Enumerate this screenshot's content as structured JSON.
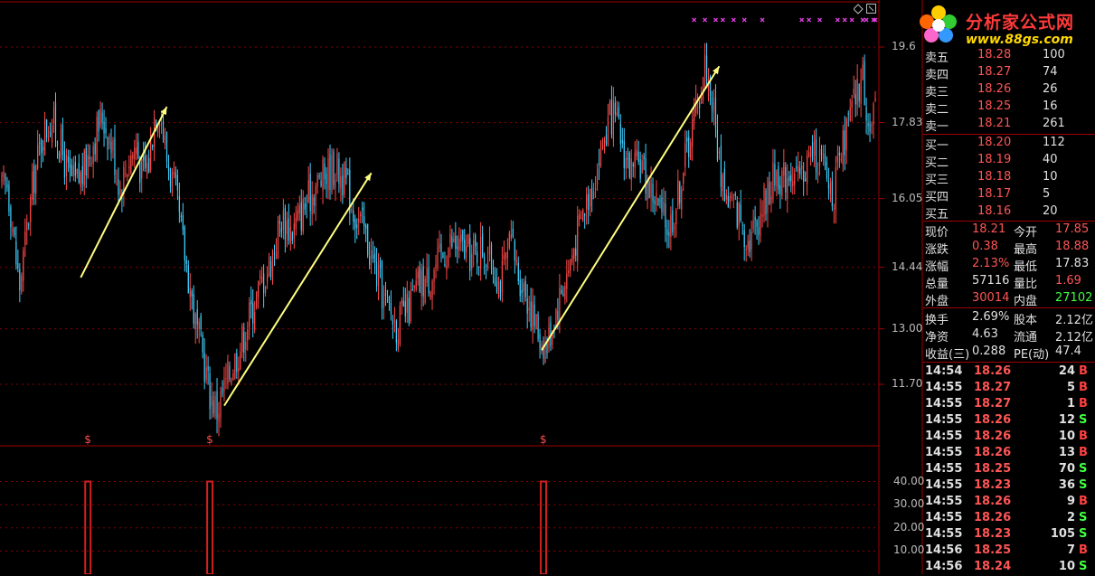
{
  "colors": {
    "up": "#ff4a4a",
    "down": "#40d0ff",
    "grid": "#8b0000",
    "arrow": "#ffff80",
    "signal": "#e040e0",
    "bar": "#d02020"
  },
  "logo": {
    "name": "分析家公式网",
    "url": "www.88gs.com"
  },
  "price_axis": {
    "labels": [
      "19.6",
      "17.83",
      "16.05",
      "14.44",
      "13.00",
      "11.70"
    ]
  },
  "volume_axis": {
    "labels": [
      "40.00",
      "30.00",
      "20.00",
      "10.00"
    ]
  },
  "window_icons": [
    "restore-icon",
    "close-icon"
  ],
  "dollar_markers": [
    "$",
    "$",
    "$"
  ],
  "quote_ask": [
    {
      "label": "卖五",
      "price": "18.28",
      "vol": "100"
    },
    {
      "label": "卖四",
      "price": "18.27",
      "vol": "74"
    },
    {
      "label": "卖三",
      "price": "18.26",
      "vol": "26"
    },
    {
      "label": "卖二",
      "price": "18.25",
      "vol": "16"
    },
    {
      "label": "卖一",
      "price": "18.21",
      "vol": "261"
    }
  ],
  "quote_bid": [
    {
      "label": "买一",
      "price": "18.20",
      "vol": "112"
    },
    {
      "label": "买二",
      "price": "18.19",
      "vol": "40"
    },
    {
      "label": "买三",
      "price": "18.18",
      "vol": "10"
    },
    {
      "label": "买四",
      "price": "18.17",
      "vol": "5"
    },
    {
      "label": "买五",
      "price": "18.16",
      "vol": "20"
    }
  ],
  "stats": [
    {
      "l1": "现价",
      "v1": "18.21",
      "l2": "今开",
      "v2": "17.85",
      "c1": "#ff5555",
      "c2": "#ff5555"
    },
    {
      "l1": "涨跌",
      "v1": "0.38",
      "l2": "最高",
      "v2": "18.88",
      "c1": "#ff5555",
      "c2": "#ff5555"
    },
    {
      "l1": "涨幅",
      "v1": "2.13%",
      "l2": "最低",
      "v2": "17.83",
      "c1": "#ff5555",
      "c2": "#e0e0e0"
    },
    {
      "l1": "总量",
      "v1": "57116",
      "l2": "量比",
      "v2": "1.69",
      "c1": "#e0e0e0",
      "c2": "#ff5555"
    },
    {
      "l1": "外盘",
      "v1": "30014",
      "l2": "内盘",
      "v2": "27102",
      "c1": "#ff5555",
      "c2": "#40ff40"
    },
    {
      "l1": "换手",
      "v1": "2.69%",
      "l2": "股本",
      "v2": "2.12亿",
      "c1": "#e0e0e0",
      "c2": "#e0e0e0"
    },
    {
      "l1": "净资",
      "v1": "4.63",
      "l2": "流通",
      "v2": "2.12亿",
      "c1": "#e0e0e0",
      "c2": "#e0e0e0"
    },
    {
      "l1": "收益(三)",
      "v1": "0.288",
      "l2": "PE(动)",
      "v2": "47.4",
      "c1": "#e0e0e0",
      "c2": "#e0e0e0"
    }
  ],
  "ticks": [
    {
      "time": "14:54",
      "price": "18.26",
      "vol": "24",
      "dir": "B"
    },
    {
      "time": "14:55",
      "price": "18.27",
      "vol": "5",
      "dir": "B"
    },
    {
      "time": "14:55",
      "price": "18.27",
      "vol": "1",
      "dir": "B"
    },
    {
      "time": "14:55",
      "price": "18.26",
      "vol": "12",
      "dir": "S"
    },
    {
      "time": "14:55",
      "price": "18.26",
      "vol": "10",
      "dir": "B"
    },
    {
      "time": "14:55",
      "price": "18.26",
      "vol": "13",
      "dir": "B"
    },
    {
      "time": "14:55",
      "price": "18.25",
      "vol": "70",
      "dir": "S"
    },
    {
      "time": "14:55",
      "price": "18.23",
      "vol": "36",
      "dir": "S"
    },
    {
      "time": "14:55",
      "price": "18.26",
      "vol": "9",
      "dir": "B"
    },
    {
      "time": "14:55",
      "price": "18.26",
      "vol": "2",
      "dir": "S"
    },
    {
      "time": "14:55",
      "price": "18.23",
      "vol": "105",
      "dir": "S"
    },
    {
      "time": "14:56",
      "price": "18.25",
      "vol": "7",
      "dir": "B"
    },
    {
      "time": "14:56",
      "price": "18.24",
      "vol": "10",
      "dir": "S"
    }
  ],
  "chart_data": {
    "type": "candlestick",
    "title": "",
    "ylim": [
      11.0,
      19.9
    ],
    "yticks": [
      19.6,
      17.83,
      16.05,
      14.44,
      13.0,
      11.7
    ],
    "volume_ylim": [
      0,
      48
    ],
    "volume_yticks": [
      40,
      30,
      20,
      10
    ],
    "waypoints": [
      [
        0,
        16.3
      ],
      [
        3,
        16.4
      ],
      [
        5,
        15.8
      ],
      [
        8,
        14.6
      ],
      [
        10,
        14.0
      ],
      [
        13,
        15.0
      ],
      [
        18,
        16.6
      ],
      [
        23,
        17.6
      ],
      [
        28,
        17.9
      ],
      [
        32,
        17.4
      ],
      [
        37,
        16.6
      ],
      [
        41,
        16.4
      ],
      [
        45,
        16.6
      ],
      [
        50,
        17.3
      ],
      [
        56,
        18.0
      ],
      [
        62,
        17.2
      ],
      [
        66,
        16.3
      ],
      [
        70,
        16.9
      ],
      [
        75,
        17.3
      ],
      [
        78,
        16.6
      ],
      [
        82,
        16.9
      ],
      [
        85,
        18.0
      ],
      [
        88,
        18.2
      ],
      [
        92,
        17.0
      ],
      [
        97,
        16.1
      ],
      [
        101,
        15.0
      ],
      [
        105,
        14.0
      ],
      [
        108,
        13.1
      ],
      [
        112,
        12.4
      ],
      [
        116,
        11.5
      ],
      [
        120,
        11.1
      ],
      [
        124,
        11.6
      ],
      [
        128,
        12.1
      ],
      [
        133,
        12.6
      ],
      [
        138,
        13.3
      ],
      [
        144,
        14.0
      ],
      [
        150,
        14.6
      ],
      [
        156,
        15.6
      ],
      [
        162,
        15.3
      ],
      [
        168,
        15.8
      ],
      [
        174,
        16.3
      ],
      [
        180,
        16.6
      ],
      [
        186,
        16.8
      ],
      [
        192,
        16.4
      ],
      [
        196,
        15.8
      ],
      [
        202,
        15.3
      ],
      [
        208,
        14.4
      ],
      [
        214,
        13.6
      ],
      [
        220,
        13.1
      ],
      [
        226,
        13.4
      ],
      [
        232,
        14.0
      ],
      [
        238,
        14.2
      ],
      [
        244,
        14.6
      ],
      [
        250,
        15.0
      ],
      [
        256,
        14.9
      ],
      [
        262,
        14.7
      ],
      [
        268,
        14.9
      ],
      [
        274,
        14.5
      ],
      [
        278,
        14.1
      ],
      [
        284,
        15.0
      ],
      [
        288,
        14.3
      ],
      [
        292,
        13.9
      ],
      [
        296,
        13.3
      ],
      [
        300,
        12.8
      ],
      [
        304,
        12.6
      ],
      [
        308,
        13.3
      ],
      [
        312,
        13.9
      ],
      [
        316,
        14.4
      ],
      [
        320,
        15.1
      ],
      [
        324,
        15.7
      ],
      [
        328,
        16.3
      ],
      [
        332,
        16.8
      ],
      [
        336,
        17.5
      ],
      [
        340,
        18.0
      ],
      [
        344,
        17.6
      ],
      [
        348,
        17.0
      ],
      [
        352,
        16.6
      ],
      [
        356,
        16.9
      ],
      [
        360,
        16.4
      ],
      [
        364,
        16.1
      ],
      [
        368,
        15.6
      ],
      [
        372,
        15.4
      ],
      [
        376,
        15.9
      ],
      [
        380,
        16.8
      ],
      [
        384,
        17.6
      ],
      [
        388,
        18.3
      ],
      [
        392,
        19.2
      ],
      [
        396,
        18.4
      ],
      [
        400,
        16.9
      ],
      [
        404,
        16.1
      ],
      [
        408,
        15.9
      ],
      [
        412,
        15.6
      ],
      [
        416,
        15.1
      ],
      [
        420,
        15.4
      ],
      [
        424,
        15.9
      ],
      [
        428,
        16.3
      ],
      [
        432,
        16.7
      ],
      [
        436,
        16.5
      ],
      [
        440,
        16.8
      ],
      [
        444,
        16.4
      ],
      [
        448,
        16.8
      ],
      [
        452,
        17.2
      ],
      [
        456,
        17.0
      ],
      [
        460,
        16.5
      ],
      [
        464,
        16.2
      ],
      [
        468,
        17.0
      ],
      [
        472,
        17.8
      ],
      [
        476,
        18.4
      ],
      [
        480,
        18.9
      ],
      [
        484,
        17.6
      ],
      [
        487,
        18.0
      ]
    ],
    "arrows": [
      {
        "from": [
          44,
          14.2
        ],
        "to": [
          92,
          18.2
        ]
      },
      {
        "from": [
          124,
          11.2
        ],
        "to": [
          206,
          16.65
        ]
      },
      {
        "from": [
          301,
          12.5
        ],
        "to": [
          400,
          19.15
        ]
      }
    ],
    "signal_days": [
      48,
      116,
      302
    ],
    "signal_volume": [
      40,
      40,
      40
    ]
  }
}
